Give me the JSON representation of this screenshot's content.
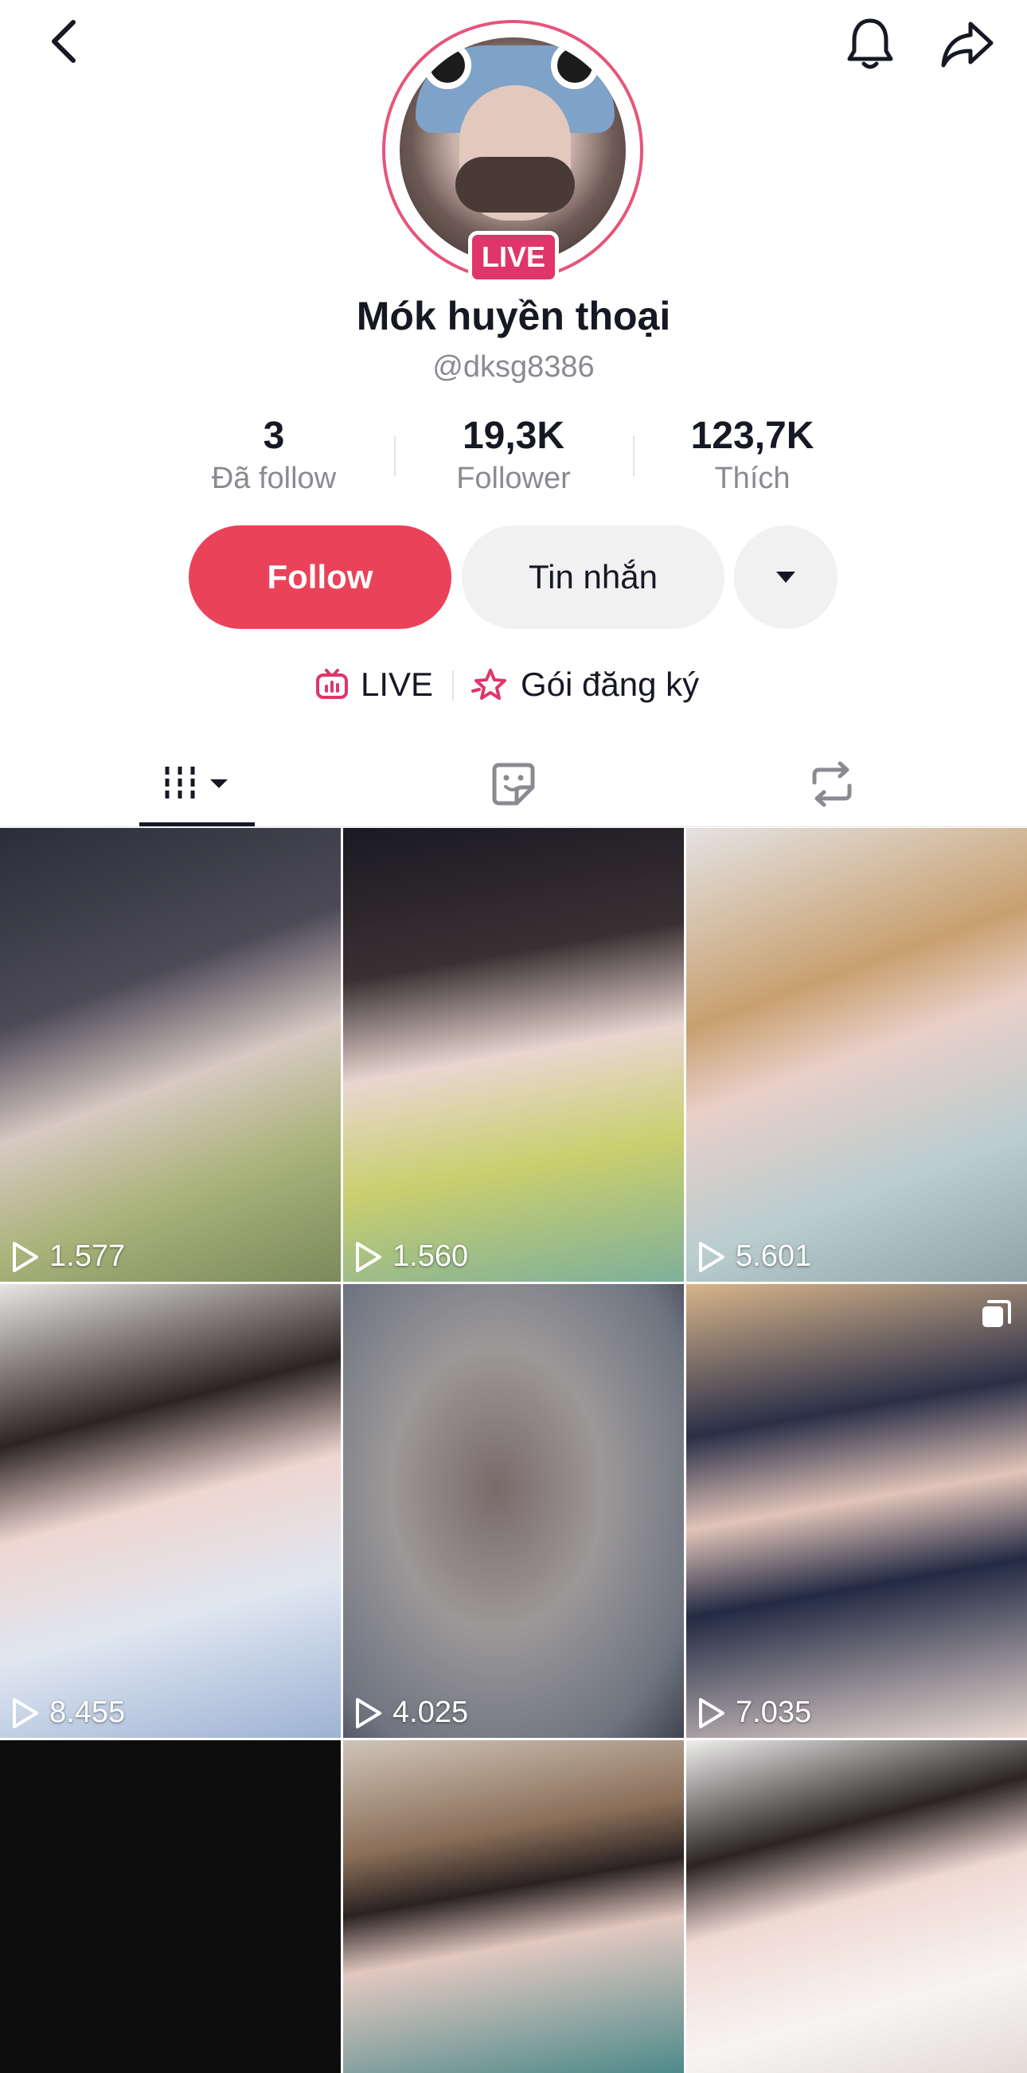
{
  "profile": {
    "display_name": "Mók huyền thoại",
    "handle": "@dksg8386",
    "live_badge": "LIVE"
  },
  "stats": [
    {
      "value": "3",
      "label": "Đã follow"
    },
    {
      "value": "19,3K",
      "label": "Follower"
    },
    {
      "value": "123,7K",
      "label": "Thích"
    }
  ],
  "actions": {
    "follow": "Follow",
    "message": "Tin nhắn"
  },
  "links": {
    "live": "LIVE",
    "subscription": "Gói đăng ký"
  },
  "icons": [
    "back-icon",
    "bell-icon",
    "share-icon",
    "dropdown-arrow-icon",
    "live-tv-icon",
    "subscription-star-icon",
    "videos-grid-icon",
    "sticker-icon",
    "repost-icon",
    "play-icon",
    "multi-photo-icon"
  ],
  "colors": {
    "accent": "#ea4359",
    "live": "#e0356a",
    "muted": "#8a8b91"
  },
  "videos": [
    {
      "views": "1.577"
    },
    {
      "views": "1.560"
    },
    {
      "views": "5.601"
    },
    {
      "views": "8.455"
    },
    {
      "views": "4.025"
    },
    {
      "views": "7.035"
    },
    {
      "views": ""
    },
    {
      "views": ""
    },
    {
      "views": ""
    }
  ]
}
